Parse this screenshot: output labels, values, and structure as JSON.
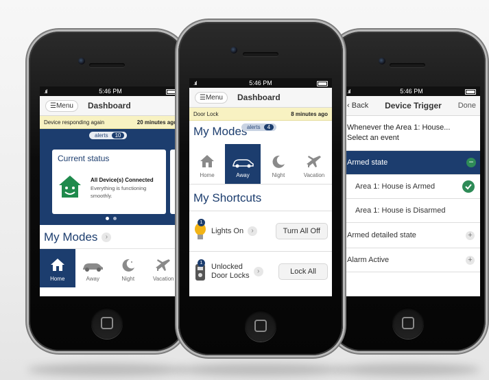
{
  "phone1": {
    "status": {
      "time": "5:46 PM"
    },
    "nav": {
      "menu": "Menu",
      "title": "Dashboard"
    },
    "alert_bar": {
      "message": "Device responding again",
      "time": "20 minutes ago"
    },
    "alerts_pill": {
      "label": "alerts",
      "count": "10"
    },
    "status_card": {
      "title": "Current status",
      "headline": "All Device(s) Connected",
      "detail": "Everything is functioning smoothly."
    },
    "modes": {
      "title": "My Modes",
      "items": [
        "Home",
        "Away",
        "Night",
        "Vacation"
      ],
      "active": "Home"
    }
  },
  "phone2": {
    "status": {
      "time": "5:46 PM"
    },
    "nav": {
      "menu": "Menu",
      "title": "Dashboard"
    },
    "alert_bar": {
      "message": "Door Lock",
      "time": "8 minutes ago"
    },
    "alerts_pill": {
      "label": "alerts",
      "count": "4"
    },
    "modes": {
      "title": "My Modes",
      "items": [
        "Home",
        "Away",
        "Night",
        "Vacation"
      ],
      "active": "Away"
    },
    "shortcuts": {
      "title": "My Shortcuts",
      "items": [
        {
          "badge": "1",
          "label": "Lights On",
          "action": "Turn All Off"
        },
        {
          "badge": "1",
          "label_line1": "Unlocked",
          "label_line2": "Door Locks",
          "action": "Lock All"
        }
      ]
    }
  },
  "phone3": {
    "status": {
      "time": "5:46 PM"
    },
    "nav": {
      "back": "Back",
      "title": "Device Trigger",
      "done": "Done"
    },
    "prompt": {
      "line1": "Whenever the Area 1: House...",
      "line2": "Select an event"
    },
    "groups": [
      {
        "label": "Armed state",
        "expanded": true,
        "options": [
          "Area 1:  House is Armed",
          "Area 1:  House is Disarmed"
        ]
      },
      {
        "label": "Armed detailed state",
        "expanded": false
      },
      {
        "label": "Alarm Active",
        "expanded": false
      }
    ]
  },
  "colors": {
    "navy": "#1c3d6e",
    "alert_yellow": "#f8f2c2",
    "success_green": "#2e8b57",
    "house_green": "#1f8a4c",
    "bulb_yellow": "#f2b416"
  }
}
